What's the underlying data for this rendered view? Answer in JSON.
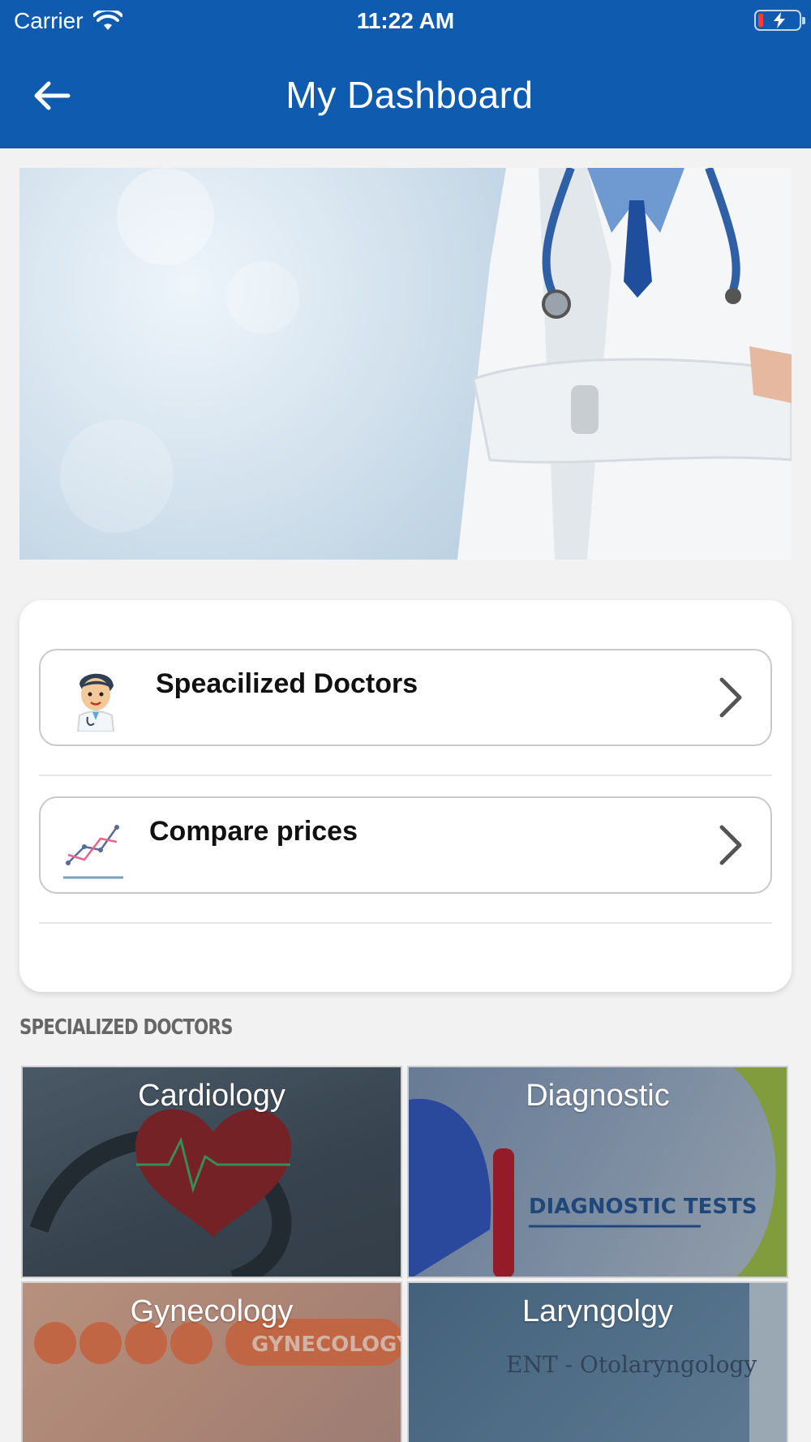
{
  "status_bar": {
    "carrier": "Carrier",
    "time": "11:22 AM"
  },
  "header": {
    "title": "My Dashboard"
  },
  "menu": {
    "items": [
      {
        "label": "Speacilized Doctors",
        "icon": "doctor-avatar-icon"
      },
      {
        "label": "Compare prices",
        "icon": "price-chart-icon"
      }
    ]
  },
  "section_title": "SPECIALIZED DOCTORS",
  "specialties": [
    {
      "name": "Cardiology",
      "banner_text": ""
    },
    {
      "name": "Diagnostic",
      "banner_text": "DIAGNOSTIC TESTS"
    },
    {
      "name": "Gynecology",
      "banner_text": "GYNECOLOGY"
    },
    {
      "name": "Laryngolgy",
      "banner_text": "ENT - Otolaryngology"
    }
  ],
  "colors": {
    "header_bg": "#0e5bb0",
    "card_bg": "#ffffff",
    "page_bg": "#f2f2f2"
  }
}
